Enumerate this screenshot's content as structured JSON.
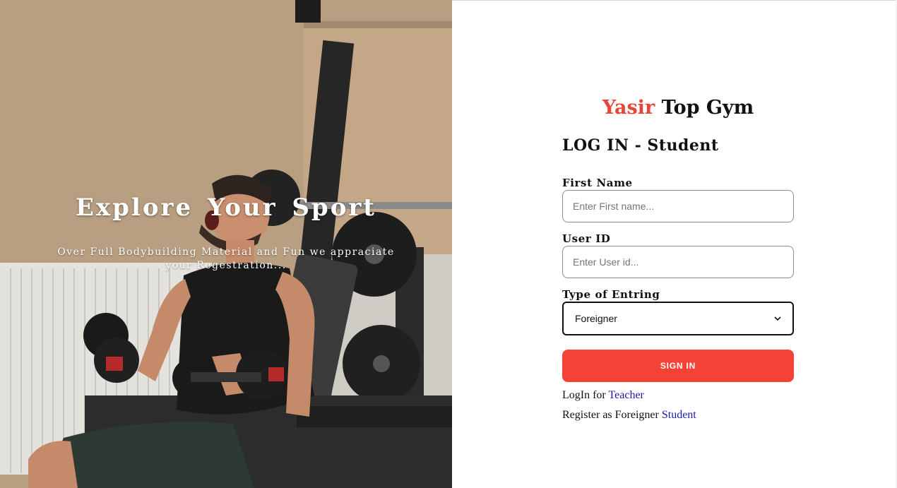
{
  "hero": {
    "title": "Explore  Your  Sport",
    "subtitle": "Over Full Bodybuilding Material and Fun we appraciate your Regestration..."
  },
  "brand": {
    "accent_word": "Yasir",
    "rest": " Top Gym"
  },
  "form": {
    "title": "LOG IN - Student",
    "first_name": {
      "label": "First Name",
      "placeholder": "Enter First name...",
      "value": ""
    },
    "user_id": {
      "label": "User ID",
      "placeholder": "Enter User id...",
      "value": ""
    },
    "entry_type": {
      "label": "Type of Entring",
      "selected": "Foreigner"
    },
    "submit_label": "SIGN IN"
  },
  "links": {
    "teacher_prefix": "LogIn for",
    "teacher_link": "Teacher",
    "register_prefix": "Register as Foreigner",
    "register_link": "Student"
  },
  "icons": {
    "select_arrow": "chevron-down-icon"
  },
  "colors": {
    "accent": "#e8443a",
    "button": "#f44336",
    "link": "#1a1aa6",
    "text": "#111111"
  }
}
